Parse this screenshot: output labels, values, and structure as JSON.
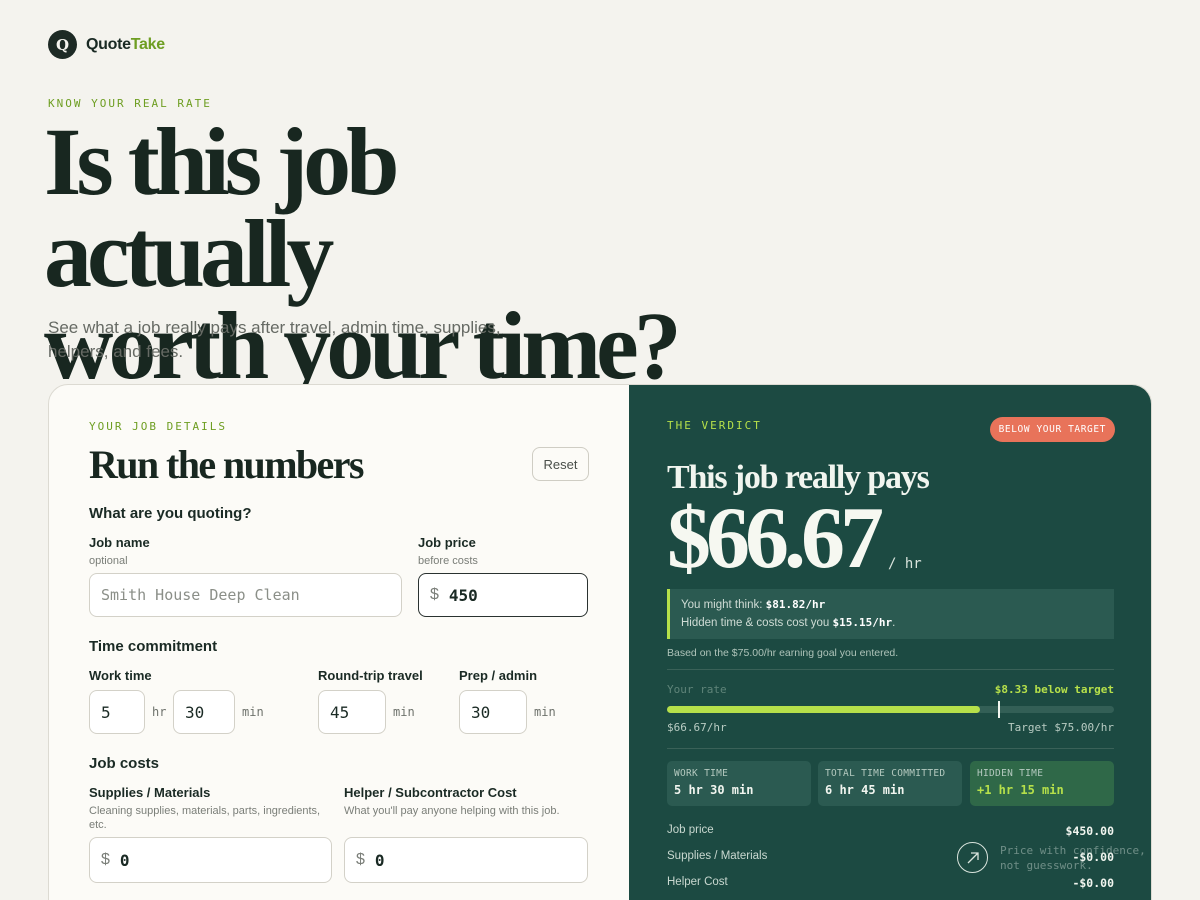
{
  "brand": {
    "name_part1": "Quote",
    "name_part2": "Take",
    "mark": "Q"
  },
  "hero": {
    "eyebrow": "KNOW YOUR REAL RATE",
    "title_line1": "Is this job actually",
    "title_line2": "worth your time?",
    "subtitle": "See what a job really pays after travel, admin time, supplies, helpers, and fees."
  },
  "form": {
    "eyebrow": "YOUR JOB DETAILS",
    "title": "Run the numbers",
    "reset_label": "Reset",
    "quoting_heading": "What are you quoting?",
    "job_name": {
      "label": "Job name",
      "hint": "optional",
      "placeholder": "Smith House Deep Clean",
      "value": ""
    },
    "job_price": {
      "label": "Job price",
      "hint": "before costs",
      "currency": "$",
      "value": "450"
    },
    "time_heading": "Time commitment",
    "work_time": {
      "label": "Work time",
      "hours": "5",
      "hours_unit": "hr",
      "minutes": "30",
      "minutes_unit": "min"
    },
    "travel": {
      "label": "Round-trip travel",
      "value": "45",
      "unit": "min"
    },
    "prep": {
      "label": "Prep / admin",
      "value": "30",
      "unit": "min"
    },
    "costs_heading": "Job costs",
    "supplies": {
      "label": "Supplies / Materials",
      "hint": "Cleaning supplies, materials, parts, ingredients, etc.",
      "currency": "$",
      "value": "0"
    },
    "helper": {
      "label": "Helper / Subcontractor Cost",
      "hint": "What you'll pay anyone helping with this job.",
      "currency": "$",
      "value": "0"
    }
  },
  "verdict": {
    "eyebrow": "THE VERDICT",
    "badge": "BELOW YOUR TARGET",
    "lead": "This job really pays",
    "rate": "$66.67",
    "per": "/ hr",
    "callout_line1_prefix": "You might think: ",
    "callout_line1_value": "$81.82/hr",
    "callout_line2_prefix": "Hidden time & costs cost you ",
    "callout_line2_value": "$15.15/hr",
    "callout_line2_suffix": ".",
    "goal_note": "Based on the $75.00/hr earning goal you entered.",
    "your_rate_label": "Your rate",
    "below_target_label": "$8.33 below target",
    "progress_fraction": 0.7,
    "target_fraction": 0.74,
    "rate_label": "$66.67/hr",
    "target_label": "Target $75.00/hr",
    "stats": [
      {
        "key": "WORK TIME",
        "value": "5 hr 30 min"
      },
      {
        "key": "TOTAL TIME COMMITTED",
        "value": "6 hr 45 min"
      },
      {
        "key": "HIDDEN TIME",
        "value": "+1 hr 15 min"
      }
    ],
    "lines": [
      {
        "label": "Job price",
        "amount": "$450.00"
      },
      {
        "label": "Supplies / Materials",
        "amount": "-$0.00"
      },
      {
        "label": "Helper Cost",
        "amount": "-$0.00"
      }
    ]
  },
  "floating": {
    "line1": "Price with confidence,",
    "line2": "not guesswork."
  },
  "colors": {
    "accent_green": "#b6e04a",
    "verdict_bg": "#1c4a42",
    "badge": "#e8735a",
    "brand_green": "#6e9e22"
  }
}
